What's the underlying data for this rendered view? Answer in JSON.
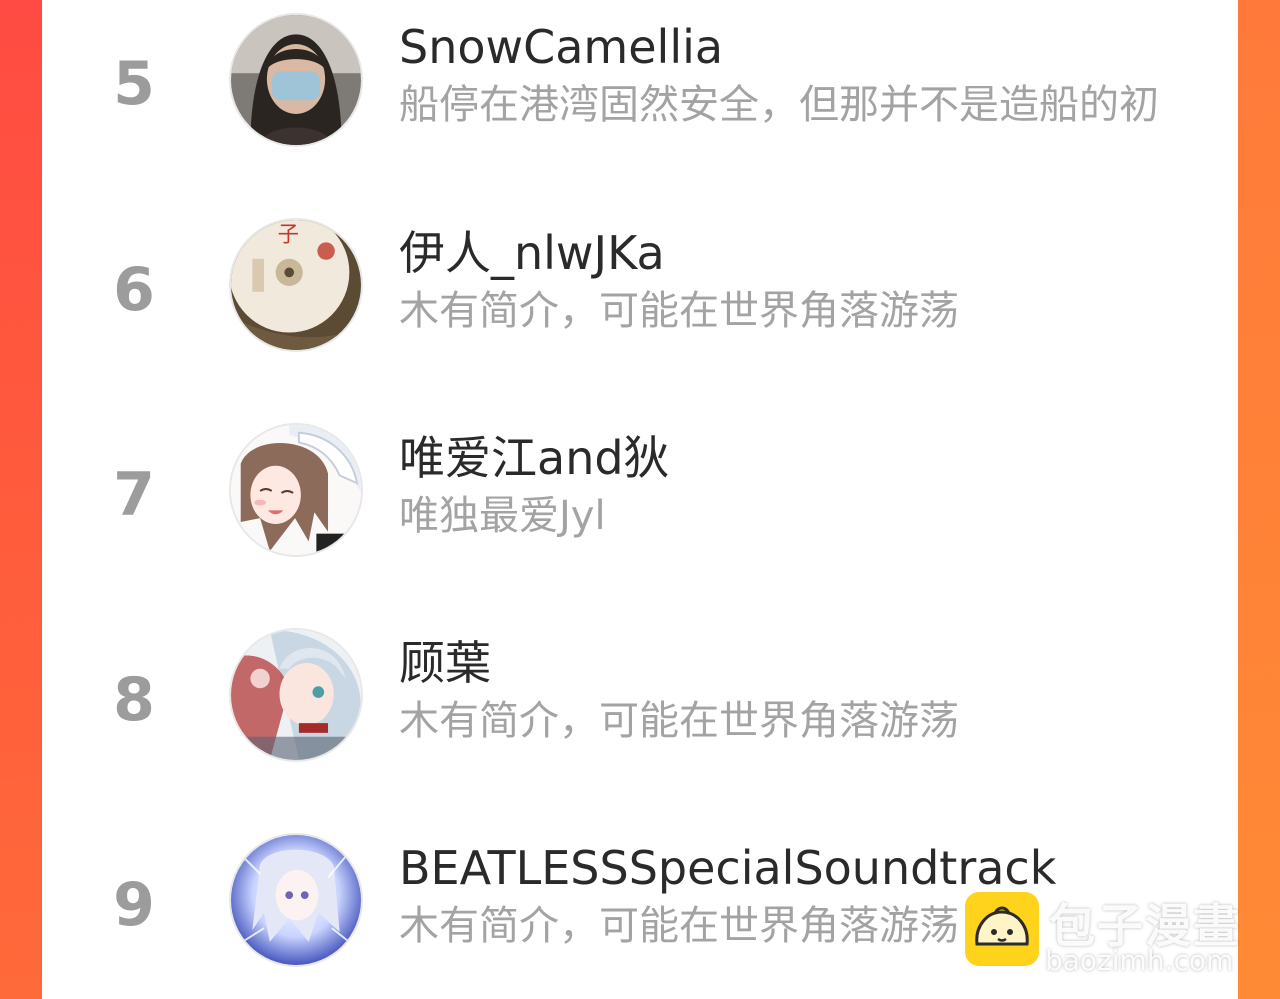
{
  "list": {
    "rows": [
      {
        "rank": "5",
        "name": "SnowCamellia",
        "bio": "船停在港湾固然安全，但那并不是造船的初"
      },
      {
        "rank": "6",
        "name": "伊人_nlwJKa",
        "bio": "木有简介，可能在世界角落游荡"
      },
      {
        "rank": "7",
        "name": "唯爱江and狄",
        "bio": "唯独最爱Jyl"
      },
      {
        "rank": "8",
        "name": "顾葉",
        "bio": "木有简介，可能在世界角落游荡"
      },
      {
        "rank": "9",
        "name": "BEATLESSSpecialSoundtrack",
        "bio": "木有简介，可能在世界角落游荡"
      }
    ]
  },
  "watermark": {
    "text": "包子漫畫",
    "url": "baozimh.com"
  },
  "colors": {
    "background_left": "#ff4b43",
    "background_right": "#ff8a35",
    "card": "#ffffff",
    "rank_text": "#9c9c9c",
    "name_text": "#2a2a2a",
    "bio_text": "#a3a3a3",
    "logo": "#ffd21c"
  }
}
